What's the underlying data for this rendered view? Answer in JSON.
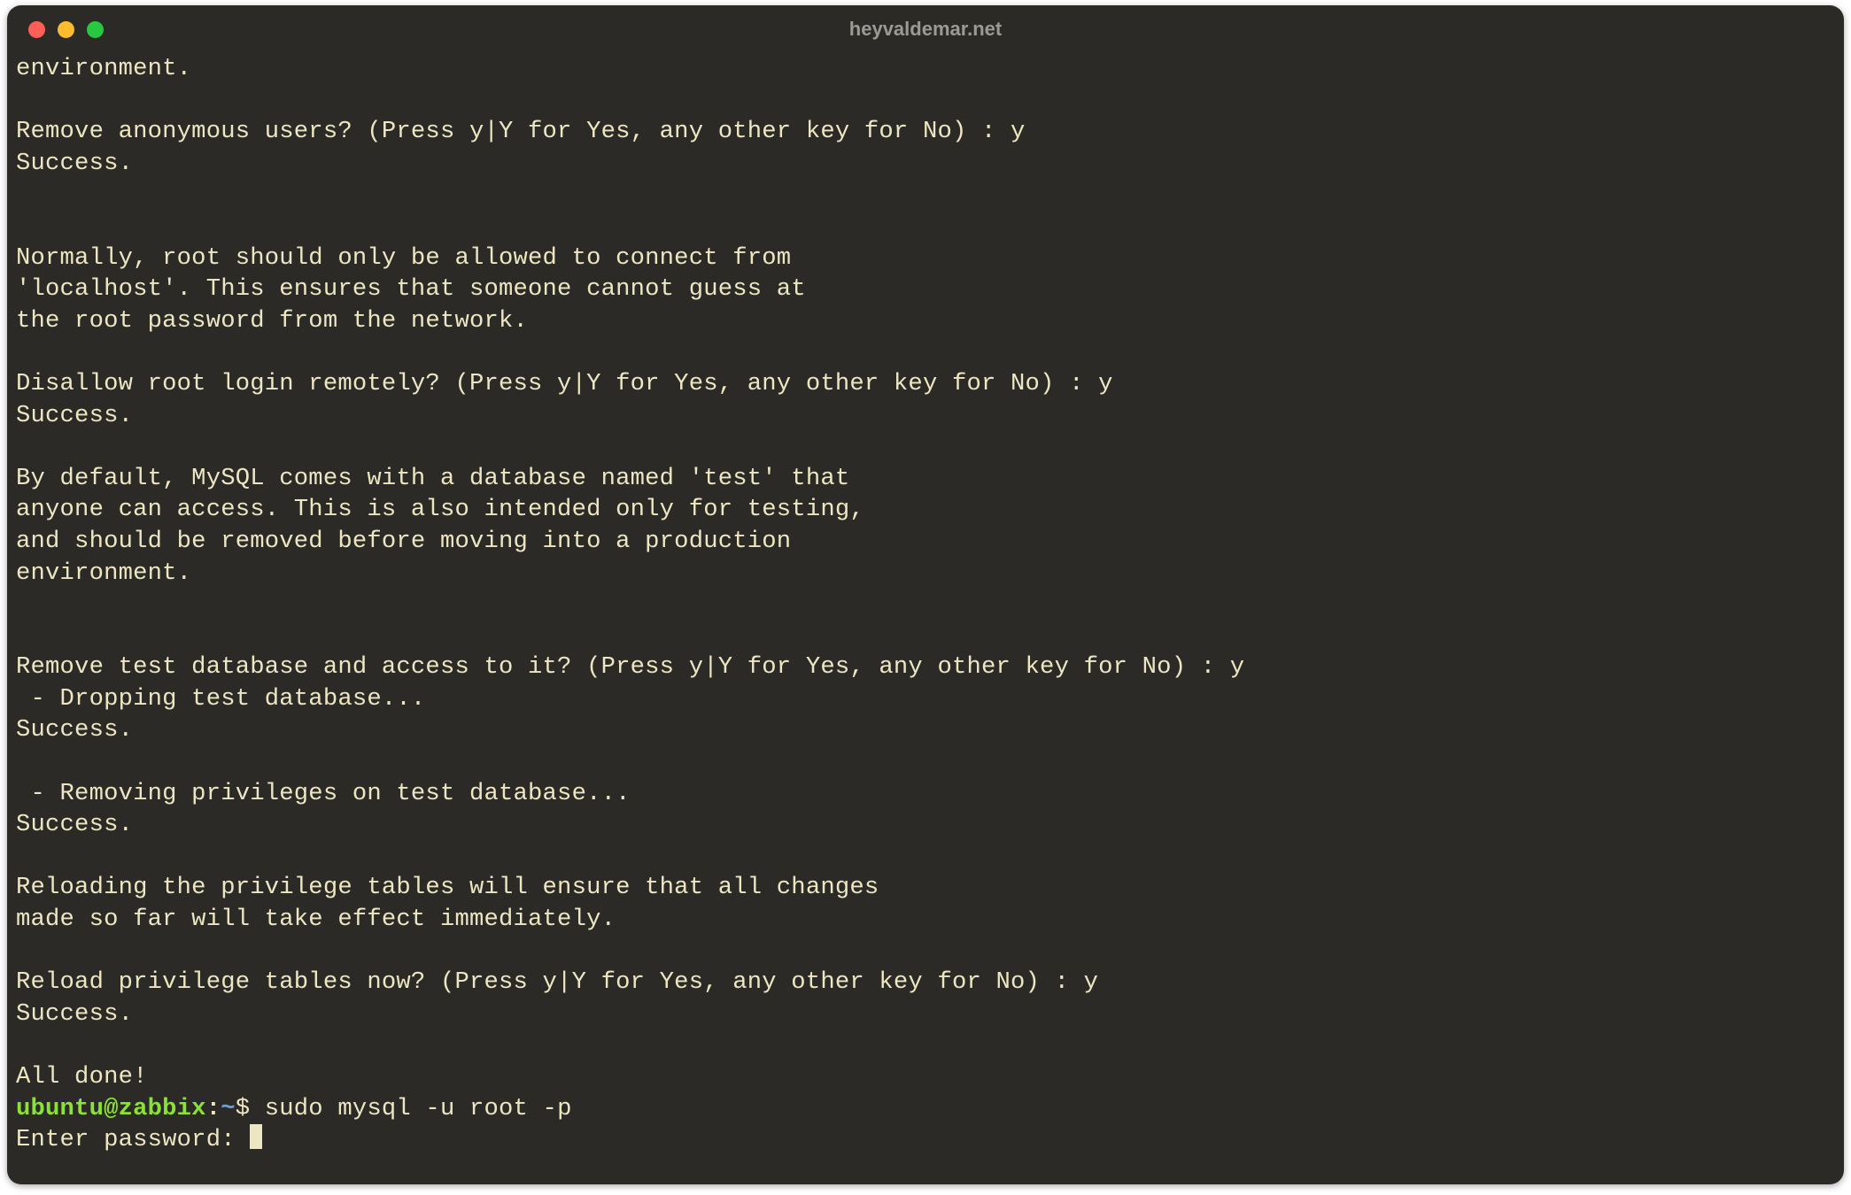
{
  "window": {
    "title": "heyvaldemar.net"
  },
  "terminal": {
    "lines": [
      "environment.",
      "",
      "Remove anonymous users? (Press y|Y for Yes, any other key for No) : y",
      "Success.",
      "",
      "",
      "Normally, root should only be allowed to connect from",
      "'localhost'. This ensures that someone cannot guess at",
      "the root password from the network.",
      "",
      "Disallow root login remotely? (Press y|Y for Yes, any other key for No) : y",
      "Success.",
      "",
      "By default, MySQL comes with a database named 'test' that",
      "anyone can access. This is also intended only for testing,",
      "and should be removed before moving into a production",
      "environment.",
      "",
      "",
      "Remove test database and access to it? (Press y|Y for Yes, any other key for No) : y",
      " - Dropping test database...",
      "Success.",
      "",
      " - Removing privileges on test database...",
      "Success.",
      "",
      "Reloading the privilege tables will ensure that all changes",
      "made so far will take effect immediately.",
      "",
      "Reload privilege tables now? (Press y|Y for Yes, any other key for No) : y",
      "Success.",
      "",
      "All done!"
    ],
    "prompt": {
      "user": "ubuntu",
      "at": "@",
      "host": "zabbix",
      "colon": ":",
      "path": "~",
      "dollar": "$",
      "command": " sudo mysql -u root -p"
    },
    "password_prompt": "Enter password: "
  }
}
